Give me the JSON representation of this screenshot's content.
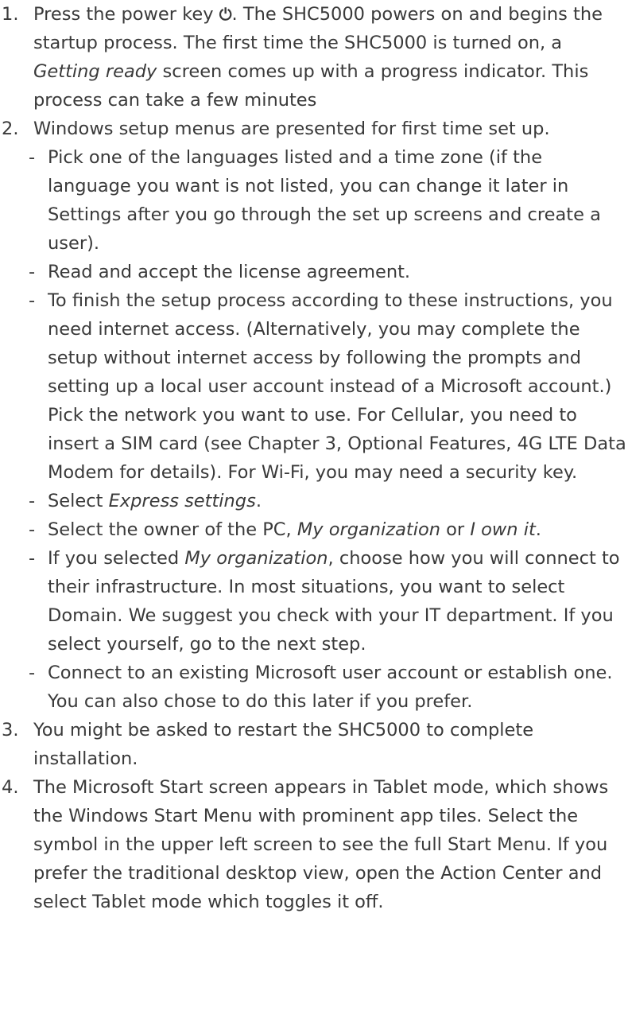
{
  "step1": {
    "num": "1.",
    "pre": "Press the power key ",
    "icon": "⏻",
    "mid": ". The SHC5000 powers on and begins the startup process. The first time the SHC5000 is turned on, a ",
    "em": "Getting ready",
    "post": " screen comes up with a progress indicator. This process can take a few minutes"
  },
  "step2": {
    "num": "2.",
    "text": "Windows setup menus are presented for first time set up.",
    "b1": "Pick one of the languages listed and a time zone (if the language you want is not listed, you can change it later in Settings after you go through the set up screens and create a user).",
    "b2": "Read and accept the license agreement.",
    "b3": "To finish the setup process according to these instructions, you need internet access. (Alternatively, you may complete the setup without internet access by following the prompts and setting up a local user account instead of a Microsoft account.) Pick the network you want to use. For Cellular, you need to insert a SIM card (see Chapter 3, Optional Features, 4G LTE Data Modem for details). For Wi-Fi, you may need a security key.",
    "b4_pre": "Select ",
    "b4_em": "Express settings",
    "b4_post": ".",
    "b5_pre": "Select the owner of the PC, ",
    "b5_em1": "My organization",
    "b5_mid": " or ",
    "b5_em2": "I own it",
    "b5_post": ".",
    "b6_pre": "If you selected ",
    "b6_em": "My organization",
    "b6_post": ", choose how you will connect to their infrastructure. In most situations, you want to select Domain. We suggest you check with your IT department. If you select yourself, go to the next step.",
    "b7": "Connect to an existing Microsoft user account or establish one. You can also chose to do this later if you prefer."
  },
  "step3": {
    "num": "3.",
    "text": "You might be asked to restart the SHC5000 to complete installation."
  },
  "step4": {
    "num": "4.",
    "text": "The Microsoft Start screen appears in Tablet mode, which shows the Windows Start Menu with prominent app tiles. Select the symbol in the upper left screen to see the full Start Menu. If you prefer the traditional desktop view, open the Action Center and select Tablet mode which toggles it off."
  },
  "bullet": "-"
}
